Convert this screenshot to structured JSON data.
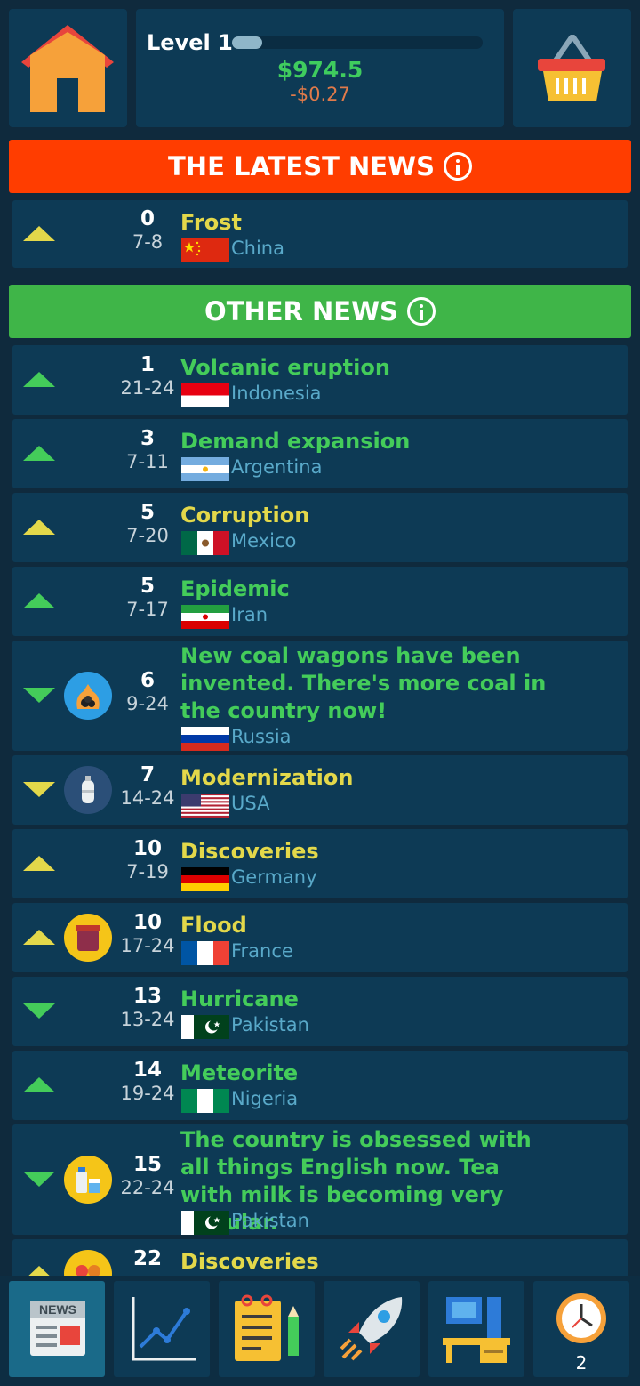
{
  "header": {
    "level_label": "Level 1",
    "level_progress": 0.12,
    "money": "$974.5",
    "money_delta": "-$0.27"
  },
  "latest_banner": {
    "title": "THE LATEST NEWS"
  },
  "latest_news": [
    {
      "dir": "up",
      "color": "yellow",
      "score": "0",
      "range": "7-8",
      "title": "Frost",
      "title_color": "yellow",
      "country": "China",
      "flag": "china"
    }
  ],
  "other_banner": {
    "title": "OTHER NEWS"
  },
  "other_news": [
    {
      "dir": "up",
      "color": "green",
      "score": "1",
      "range": "21-24",
      "title": "Volcanic eruption",
      "title_color": "green",
      "country": "Indonesia",
      "flag": "indonesia"
    },
    {
      "dir": "up",
      "color": "green",
      "score": "3",
      "range": "7-11",
      "title": "Demand expansion",
      "title_color": "green",
      "country": "Argentina",
      "flag": "argentina"
    },
    {
      "dir": "up",
      "color": "yellow",
      "score": "5",
      "range": "7-20",
      "title": "Corruption",
      "title_color": "yellow",
      "country": "Mexico",
      "flag": "mexico"
    },
    {
      "dir": "up",
      "color": "green",
      "score": "5",
      "range": "7-17",
      "title": "Epidemic",
      "title_color": "green",
      "country": "Iran",
      "flag": "iran"
    },
    {
      "dir": "down",
      "color": "green",
      "badge": "coal-bag-icon",
      "score": "6",
      "range": "9-24",
      "title": "New coal wagons have been invented. There's more coal in the country now!",
      "title_color": "green",
      "country": "Russia",
      "flag": "russia"
    },
    {
      "dir": "down",
      "color": "yellow",
      "badge": "gas-cylinder-icon",
      "score": "7",
      "range": "14-24",
      "title": "Modernization",
      "title_color": "yellow",
      "country": "USA",
      "flag": "usa"
    },
    {
      "dir": "up",
      "color": "yellow",
      "score": "10",
      "range": "7-19",
      "title": "Discoveries",
      "title_color": "yellow",
      "country": "Germany",
      "flag": "germany"
    },
    {
      "dir": "up",
      "color": "yellow",
      "badge": "jar-icon",
      "score": "10",
      "range": "17-24",
      "title": "Flood",
      "title_color": "yellow",
      "country": "France",
      "flag": "france"
    },
    {
      "dir": "down",
      "color": "green",
      "score": "13",
      "range": "13-24",
      "title": "Hurricane",
      "title_color": "green",
      "country": "Pakistan",
      "flag": "pakistan"
    },
    {
      "dir": "up",
      "color": "green",
      "score": "14",
      "range": "19-24",
      "title": "Meteorite",
      "title_color": "green",
      "country": "Nigeria",
      "flag": "nigeria"
    },
    {
      "dir": "down",
      "color": "green",
      "badge": "milk-icon",
      "score": "15",
      "range": "22-24",
      "title": "The country is obsessed with all things English now. Tea with milk is becoming very popular.",
      "title_color": "green",
      "country": "Pakistan",
      "flag": "pakistan"
    },
    {
      "dir": "up",
      "color": "yellow",
      "badge": "fruit-icon",
      "score": "22",
      "range": "",
      "title": "Discoveries",
      "title_color": "yellow",
      "country": "",
      "flag": ""
    }
  ],
  "bottom_nav": [
    {
      "name": "news",
      "icon": "newspaper-icon",
      "label": "NEWS",
      "active": true
    },
    {
      "name": "charts",
      "icon": "chart-icon"
    },
    {
      "name": "notes",
      "icon": "notepad-icon"
    },
    {
      "name": "launch",
      "icon": "rocket-icon"
    },
    {
      "name": "office",
      "icon": "desk-computer-icon"
    },
    {
      "name": "clock",
      "icon": "clock-icon",
      "badge": "2"
    }
  ],
  "colors": {
    "latest_banner": "#ff3d00",
    "other_banner": "#3fb548",
    "green": "#44cc5a",
    "yellow": "#e3d84a",
    "row_bg": "#0d3a55"
  }
}
